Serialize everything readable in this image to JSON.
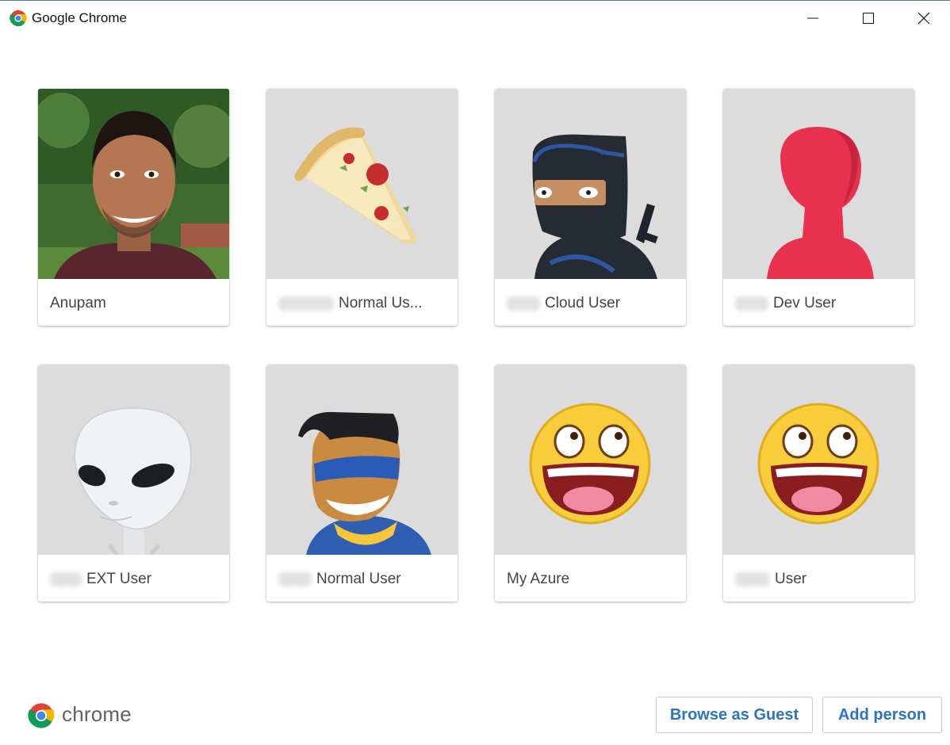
{
  "window": {
    "title": "Google Chrome",
    "controls": [
      "minimize",
      "maximize",
      "close"
    ]
  },
  "profiles": [
    {
      "name": "Anupam",
      "redacted_prefix": false,
      "avatar": "photo-person"
    },
    {
      "name": "Normal Us...",
      "redacted_prefix": true,
      "avatar": "pizza-icon"
    },
    {
      "name": "Cloud User",
      "redacted_prefix": true,
      "avatar": "ninja-icon"
    },
    {
      "name": "Dev User",
      "redacted_prefix": true,
      "avatar": "red-silhouette-icon"
    },
    {
      "name": "EXT User",
      "redacted_prefix": true,
      "avatar": "alien-icon"
    },
    {
      "name": "Normal User",
      "redacted_prefix": true,
      "avatar": "superhero-icon"
    },
    {
      "name": "My Azure",
      "redacted_prefix": false,
      "avatar": "awesome-smiley-icon"
    },
    {
      "name": "User",
      "redacted_prefix": true,
      "avatar": "awesome-smiley-icon"
    }
  ],
  "footer": {
    "brand": "chrome",
    "guest_button": "Browse as Guest",
    "add_button": "Add person"
  },
  "colors": {
    "accent": "#2b73c9",
    "avatar_bg": "#dcdcdc"
  }
}
